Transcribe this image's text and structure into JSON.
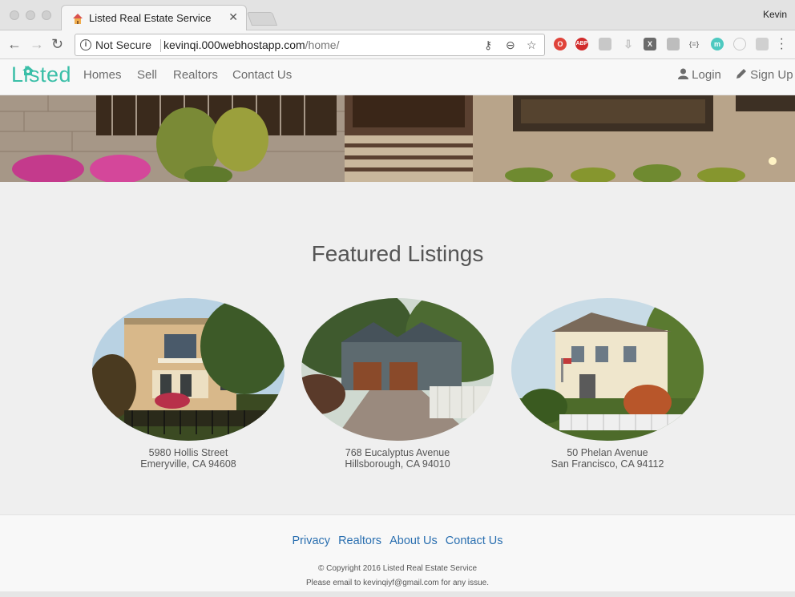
{
  "browser": {
    "tab_title": "Listed Real Estate Service",
    "profile_name": "Kevin",
    "security_label": "Not Secure",
    "url_host": "kevinqi.000webhostapp.com",
    "url_path": "/home/",
    "extensions": [
      "opera-icon",
      "adblock-icon",
      "shield-icon",
      "download-icon",
      "x-icon",
      "box-icon",
      "json-icon",
      "m-icon",
      "eye-icon",
      "grid-icon"
    ]
  },
  "site": {
    "logo_text": "Listed",
    "brand_color": "#3bbfa8",
    "nav": [
      "Homes",
      "Sell",
      "Realtors",
      "Contact Us"
    ],
    "login_label": "Login",
    "signup_label": "Sign Up"
  },
  "featured": {
    "title": "Featured Listings",
    "listings": [
      {
        "street": "5980 Hollis Street",
        "city": "Emeryville, CA 94608"
      },
      {
        "street": "768 Eucalyptus Avenue",
        "city": "Hillsborough, CA 94010"
      },
      {
        "street": "50 Phelan Avenue",
        "city": "San Francisco, CA 94112"
      }
    ]
  },
  "footer": {
    "links": [
      "Privacy",
      "Realtors",
      "About Us",
      "Contact Us"
    ],
    "copyright": "© Copyright 2016 Listed Real Estate Service",
    "contact_note": "Please email to kevinqiyf@gmail.com for any issue.",
    "link_color": "#2a6fb0"
  }
}
